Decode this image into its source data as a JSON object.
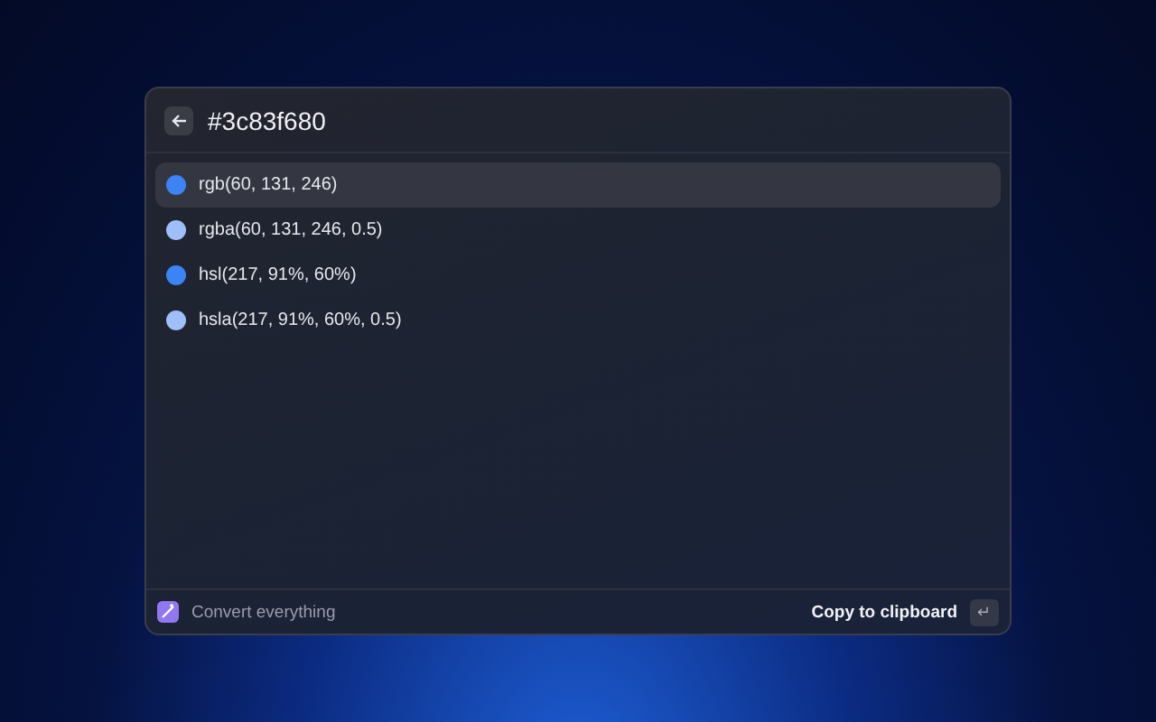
{
  "search": {
    "value": "#3c83f680"
  },
  "results": [
    {
      "label": "rgb(60, 131, 246)",
      "color": "#3c83f6",
      "selected": true
    },
    {
      "label": "rgba(60, 131, 246, 0.5)",
      "color": "#9ebff8",
      "selected": false
    },
    {
      "label": "hsl(217, 91%, 60%)",
      "color": "#3c83f6",
      "selected": false
    },
    {
      "label": "hsla(217, 91%, 60%, 0.5)",
      "color": "#9ebff8",
      "selected": false
    }
  ],
  "footer": {
    "command": "Convert everything",
    "action": "Copy to clipboard",
    "action_key": "↵"
  }
}
